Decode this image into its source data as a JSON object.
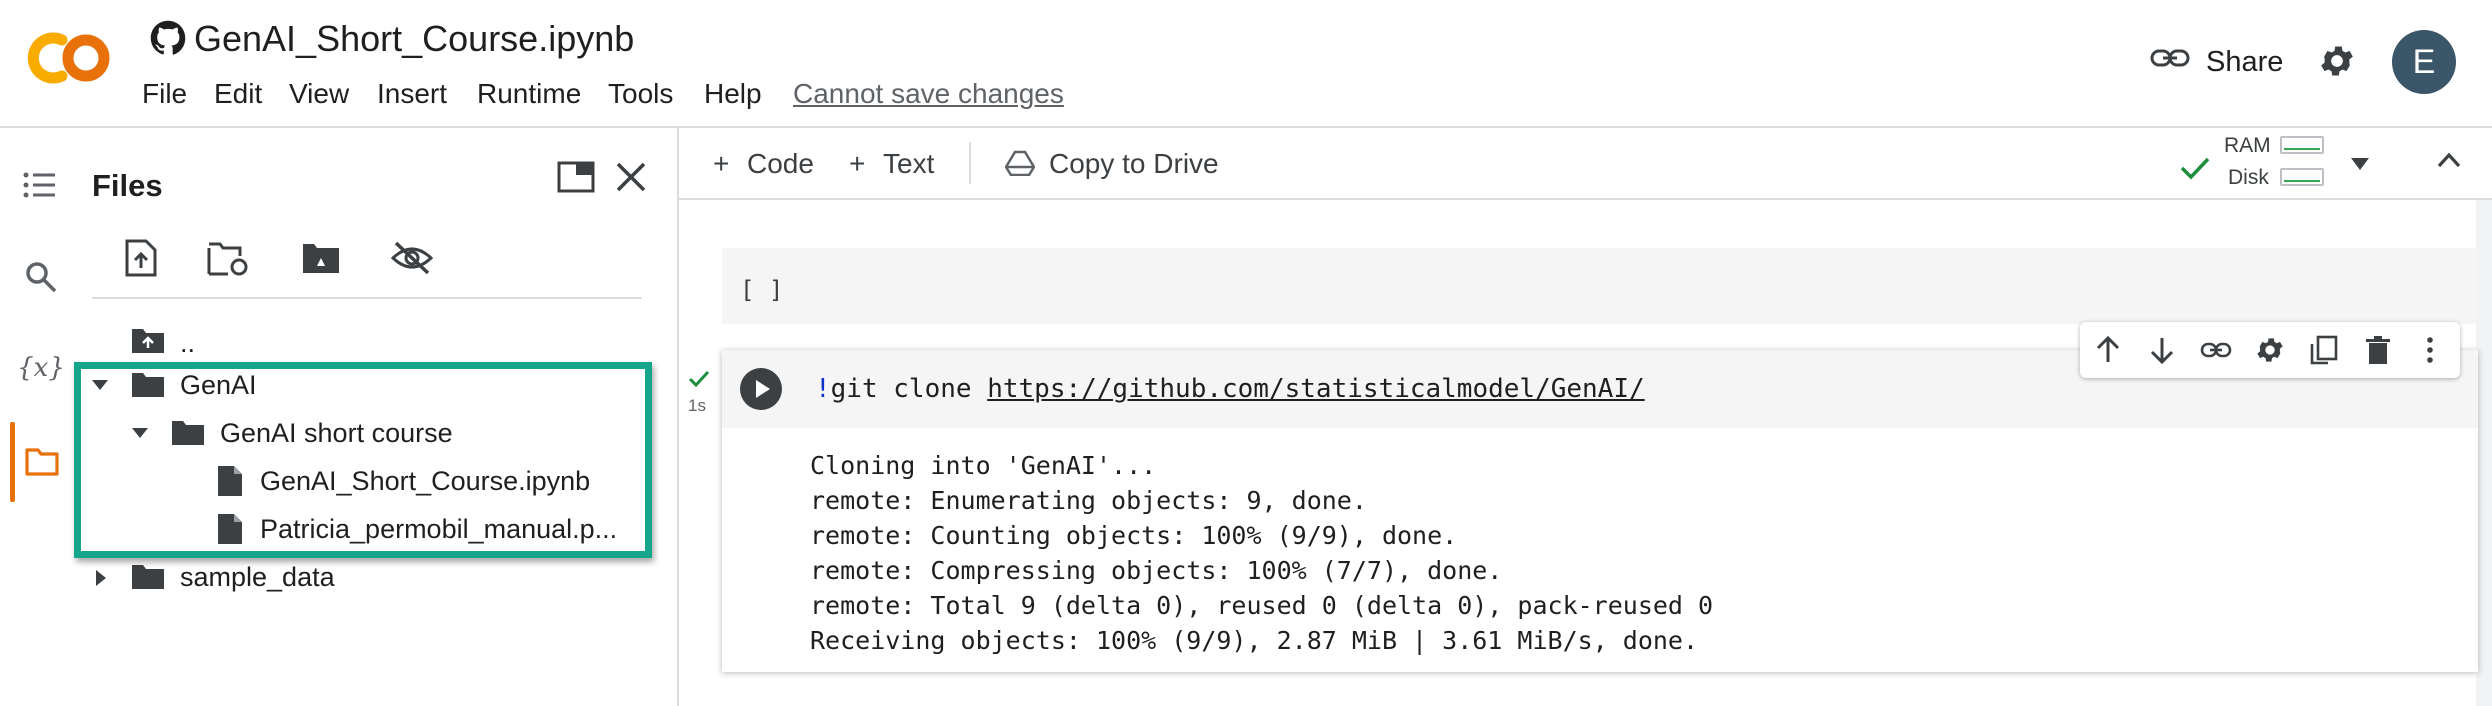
{
  "header": {
    "title": "GenAI_Short_Course.ipynb",
    "menu": [
      "File",
      "Edit",
      "View",
      "Insert",
      "Runtime",
      "Tools",
      "Help"
    ],
    "save_status": "Cannot save changes",
    "share_label": "Share",
    "avatar_letter": "E",
    "logo_text": "CO",
    "logo_color": "#F9AB00"
  },
  "files_panel": {
    "title": "Files",
    "tree": [
      {
        "label": "..",
        "type": "parent"
      },
      {
        "label": "GenAI",
        "type": "folder",
        "expanded": true
      },
      {
        "label": "GenAI short course",
        "type": "folder",
        "expanded": true
      },
      {
        "label": "GenAI_Short_Course.ipynb",
        "type": "file"
      },
      {
        "label": "Patricia_permobil_manual.p...",
        "type": "file"
      },
      {
        "label": "sample_data",
        "type": "folder",
        "expanded": false
      }
    ],
    "highlight_color": "#14A58B"
  },
  "toolbar": {
    "add_code": "Code",
    "add_text": "Text",
    "copy_to_drive": "Copy to Drive",
    "ram_label": "RAM",
    "disk_label": "Disk"
  },
  "notebook": {
    "empty_cell_prompt": "[ ]",
    "exec_time": "1s",
    "code_bang": "!",
    "code_cmd": "git clone ",
    "code_url": "https://github.com/statisticalmodel/GenAI/",
    "output_lines": [
      "Cloning into 'GenAI'...",
      "remote: Enumerating objects: 9, done.",
      "remote: Counting objects: 100% (9/9), done.",
      "remote: Compressing objects: 100% (7/7), done.",
      "remote: Total 9 (delta 0), reused 0 (delta 0), pack-reused 0",
      "Receiving objects: 100% (9/9), 2.87 MiB | 3.61 MiB/s, done."
    ]
  },
  "colors": {
    "accent_orange": "#E8710A",
    "status_green": "#1E8E3E",
    "avatar_bg": "#3B5668"
  }
}
